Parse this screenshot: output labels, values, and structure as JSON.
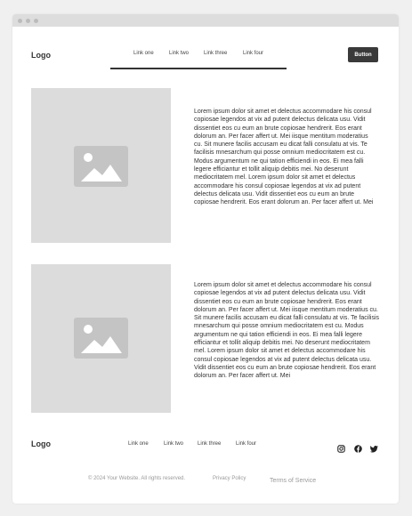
{
  "header": {
    "logo": "Logo",
    "nav": [
      "Link one",
      "Link two",
      "Link three",
      "Link four"
    ],
    "button_label": "Button"
  },
  "sections": [
    {
      "text": "Lorem ipsum dolor sit amet et delectus accommodare his consul copiosae legendos at vix ad putent delectus delicata usu. Vidit dissentiet eos cu eum an brute copiosae hendrerit. Eos erant dolorum an. Per facer affert ut. Mei iisque mentitum moderatius cu. Sit munere facilis accusam eu dicat falli consulatu at vis. Te facilisis mnesarchum qui posse omnium mediocritatem est cu. Modus argumentum ne qui tation efficiendi in eos. Ei mea falli legere efficiantur et tollit aliquip debitis mei. No deserunt mediocritatem mel. Lorem ipsum dolor sit amet et delectus accommodare his consul copiosae legendos at vix ad putent delectus delicata usu. Vidit dissentiet eos cu eum an brute copiosae hendrerit. Eos erant dolorum an. Per facer affert ut. Mei"
    },
    {
      "text": "Lorem ipsum dolor sit amet et delectus accommodare his consul copiosae legendos at vix ad putent delectus delicata usu. Vidit dissentiet eos cu eum an brute copiosae hendrerit. Eos erant dolorum an. Per facer affert ut. Mei iisque mentitum moderatius cu. Sit munere facilis accusam eu dicat falli consulatu at vis. Te facilisis mnesarchum qui posse omnium mediocritatem est cu. Modus argumentum ne qui tation efficiendi in eos. Ei mea falli legere efficiantur et tollit aliquip debitis mei. No deserunt mediocritatem mel. Lorem ipsum dolor sit amet et delectus accommodare his consul copiosae legendos at vix ad putent delectus delicata usu. Vidit dissentiet eos cu eum an brute copiosae hendrerit. Eos erant dolorum an. Per facer affert ut. Mei"
    }
  ],
  "footer": {
    "logo": "Logo",
    "nav": [
      "Link one",
      "Link two",
      "Link three",
      "Link four"
    ],
    "social_icons": [
      "instagram-icon",
      "facebook-icon",
      "twitter-icon"
    ],
    "copyright": "© 2024 Your Website. All rights reserved.",
    "privacy": "Privacy Policy",
    "terms": "Terms of Service"
  },
  "colors": {
    "background": "#f0f0f0",
    "surface": "#ffffff",
    "placeholder": "#dcdcdc",
    "button": "#3a3a3a",
    "text": "#333333"
  }
}
